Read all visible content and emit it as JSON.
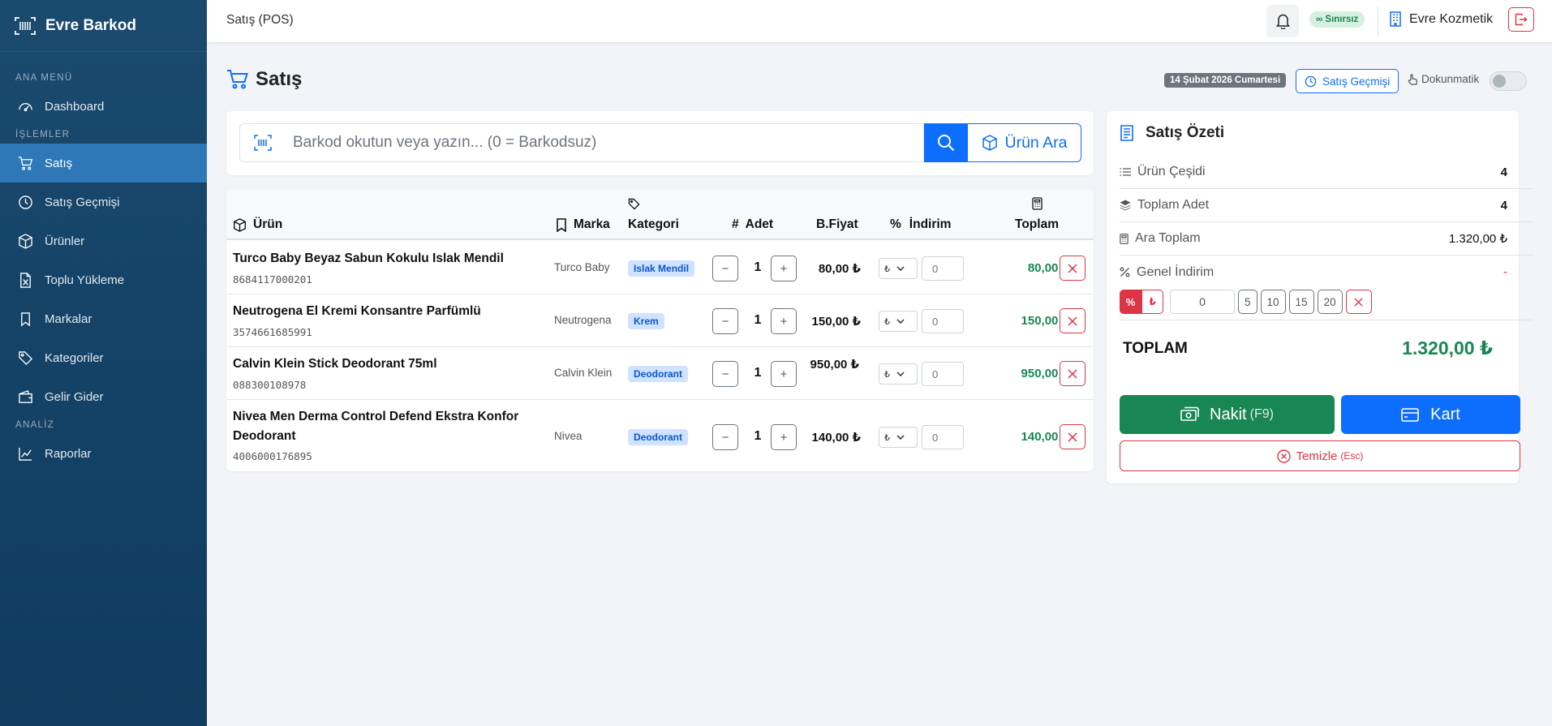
{
  "sidebar": {
    "brand": "Evre Barkod",
    "sections": {
      "main": "ANA MENÜ",
      "ops": "İŞLEMLER",
      "analysis": "ANALİZ"
    },
    "items": {
      "dashboard": "Dashboard",
      "sales": "Satış",
      "sales_history": "Satış Geçmişi",
      "products": "Ürünler",
      "bulk_upload": "Toplu Yükleme",
      "brands": "Markalar",
      "categories": "Kategoriler",
      "income_expense": "Gelir Gider",
      "reports": "Raporlar"
    }
  },
  "topbar": {
    "title": "Satış (POS)",
    "license_badge": "∞ Sınırsız",
    "company": "Evre Kozmetik"
  },
  "page": {
    "title": "Satış",
    "date_badge": "14 Şubat 2026 Cumartesi",
    "history_button": "Satış Geçmişi",
    "touch_label": "Dokunmatik"
  },
  "search": {
    "placeholder": "Barkod okutun veya yazın... (0 = Barkodsuz)",
    "find_button": "Ürün Ara"
  },
  "table": {
    "headers": {
      "product": "Ürün",
      "brand": "Marka",
      "category": "Kategori",
      "hash": "#",
      "qty": "Adet",
      "unit_price": "B.Fiyat",
      "percent": "%",
      "discount": "İndirim",
      "total": "Toplam"
    },
    "rows": [
      {
        "name": "Turco Baby Beyaz Sabun Kokulu Islak Mendil",
        "barcode": "8684117000201",
        "brand": "Turco Baby",
        "category": "Islak Mendil",
        "qty": "1",
        "price": "80,00 ₺",
        "disc_type": "₺",
        "discount": "0",
        "total": "80,00 ₺"
      },
      {
        "name": "Neutrogena El Kremi Konsantre Parfümlü",
        "barcode": "3574661685991",
        "brand": "Neutrogena",
        "category": "Krem",
        "qty": "1",
        "price": "150,00 ₺",
        "disc_type": "₺",
        "discount": "0",
        "total": "150,00 ₺"
      },
      {
        "name": "Calvin Klein Stick Deodorant 75ml",
        "barcode": "088300108978",
        "brand": "Calvin Klein",
        "category": "Deodorant",
        "qty": "1",
        "price": "950,00 ₺",
        "disc_type": "₺",
        "discount": "0",
        "total": "950,00 ₺"
      },
      {
        "name": "Nivea Men Derma Control Defend Ekstra Konfor Deodorant",
        "barcode": "4006000176895",
        "brand": "Nivea",
        "category": "Deodorant",
        "qty": "1",
        "price": "140,00 ₺",
        "disc_type": "₺",
        "discount": "0",
        "total": "140,00 ₺"
      }
    ]
  },
  "summary": {
    "title": "Satış Özeti",
    "variety_label": "Ürün Çeşidi",
    "variety_value": "4",
    "qty_label": "Toplam Adet",
    "qty_value": "4",
    "subtotal_label": "Ara Toplam",
    "subtotal_value": "1.320,00 ₺",
    "discount_label": "Genel İndirim",
    "discount_value": "-",
    "disc_percent": "%",
    "disc_currency": "₺",
    "disc_input": "0",
    "presets": [
      "5",
      "10",
      "15",
      "20"
    ],
    "grand_label": "TOPLAM",
    "grand_value": "1.320,00 ₺",
    "cash_button": "Nakit",
    "cash_hotkey": "(F9)",
    "card_button": "Kart",
    "clear_button": "Temizle",
    "clear_hotkey": "(Esc)"
  },
  "colors": {
    "sidebar": "#0f3b60",
    "active": "#2e78b8",
    "primary": "#0d6efd",
    "success": "#198754",
    "danger": "#dc3545"
  }
}
